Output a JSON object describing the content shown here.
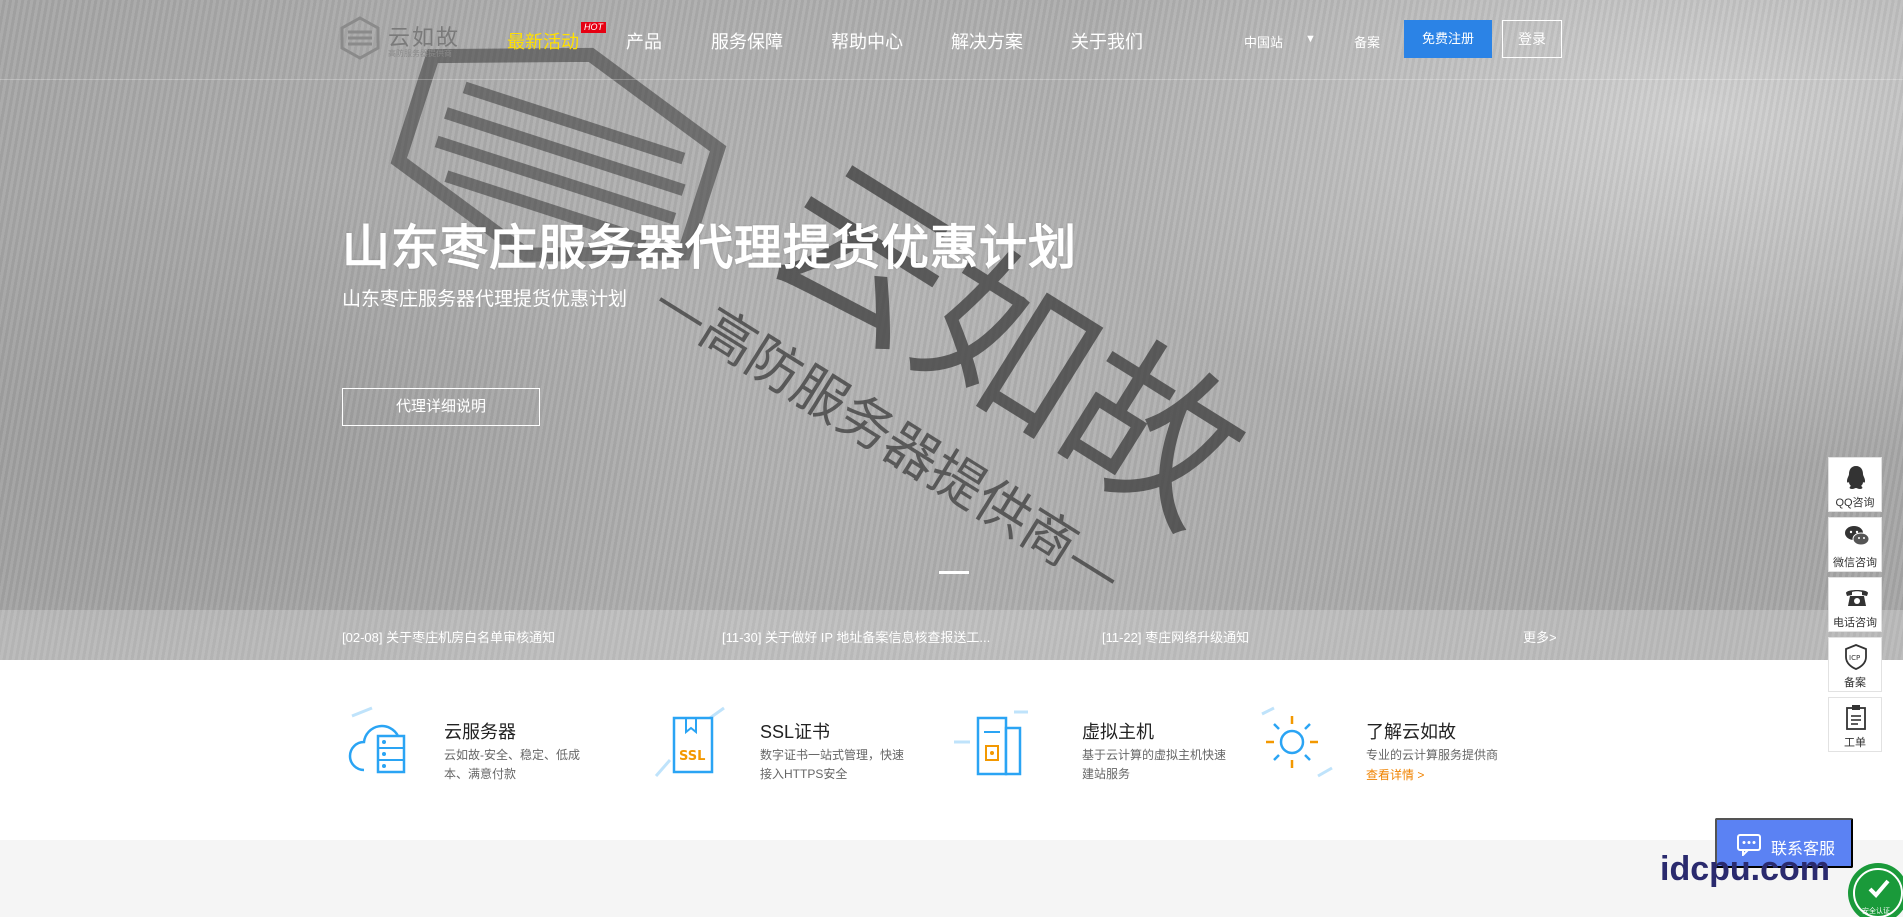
{
  "header": {
    "logo_text": "云如故",
    "logo_sub": "高防服务器提供商",
    "nav": [
      {
        "label": "最新活动",
        "badge": "HOT",
        "active": true
      },
      {
        "label": "产品"
      },
      {
        "label": "服务保障"
      },
      {
        "label": "帮助中心"
      },
      {
        "label": "解决方案"
      },
      {
        "label": "关于我们"
      }
    ],
    "region": "中国站",
    "region_caret": "▼",
    "beian": "备案",
    "register": "免费注册",
    "login": "登录"
  },
  "hero": {
    "title": "山东枣庄服务器代理提货优惠计划",
    "subtitle": "山东枣庄服务器代理提货优惠计划",
    "button": "代理详细说明",
    "bg_text_main": "云如故",
    "bg_text_sub": "—高防服务器提供商—"
  },
  "news": {
    "items": [
      "[02-08] 关于枣庄机房白名单审核通知",
      "[11-30] 关于做好 IP 地址备案信息核查报送工...",
      "[11-22] 枣庄网络升级通知"
    ],
    "more": "更多>"
  },
  "features": [
    {
      "icon": "cloud-server-icon",
      "title": "云服务器",
      "desc": "云如故-安全、稳定、低成本、满意付款"
    },
    {
      "icon": "ssl-certificate-icon",
      "title": "SSL证书",
      "desc": "数字证书一站式管理，快速接入HTTPS安全",
      "icon_text": "SSL"
    },
    {
      "icon": "virtual-host-icon",
      "title": "虚拟主机",
      "desc": "基于云计算的虚拟主机快速建站服务"
    },
    {
      "icon": "sun-icon",
      "title": "了解云如故",
      "desc": "专业的云计算服务提供商",
      "link": "查看详情 >"
    }
  ],
  "sidebar": [
    {
      "icon": "qq-icon",
      "label": "QQ咨询"
    },
    {
      "icon": "wechat-icon",
      "label": "微信咨询"
    },
    {
      "icon": "phone-icon",
      "label": "电话咨询"
    },
    {
      "icon": "icp-icon",
      "label": "备案",
      "icon_text": "ICP"
    },
    {
      "icon": "ticket-icon",
      "label": "工单"
    }
  ],
  "contact": {
    "label": "联系客服"
  },
  "watermark": "idcpu.com",
  "seal_text": "安全认证",
  "colors": {
    "accent": "#2b83e6",
    "active_nav": "#ffe000",
    "hot": "#e60012",
    "link_orange": "#f08300",
    "icon_blue": "#2aa4f4",
    "contact": "#5b82f3"
  }
}
